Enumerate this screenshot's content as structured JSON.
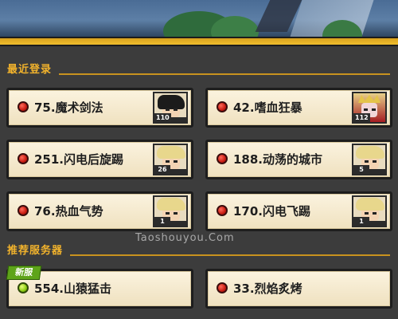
{
  "sections": {
    "recent": "最近登录",
    "recommended": "推荐服务器"
  },
  "recent_servers": [
    {
      "label": "75.魔术剑法",
      "status": "red",
      "avatar": "black-hair-hero",
      "level": "110"
    },
    {
      "label": "42.嗜血狂暴",
      "status": "red",
      "avatar": "crowned-villain",
      "level": "112"
    },
    {
      "label": "251.闪电后旋踢",
      "status": "red",
      "avatar": "blond-cyborg",
      "level": "26"
    },
    {
      "label": "188.动荡的城市",
      "status": "red",
      "avatar": "blond-cyborg",
      "level": "5"
    },
    {
      "label": "76.热血气势",
      "status": "red",
      "avatar": "blond-cyborg",
      "level": "1"
    },
    {
      "label": "170.闪电飞踢",
      "status": "red",
      "avatar": "blond-cyborg",
      "level": "1"
    }
  ],
  "recommended_servers": [
    {
      "label": "554.山猿猛击",
      "status": "green",
      "badge": "新服"
    },
    {
      "label": "33.烈焰炙烤",
      "status": "red"
    }
  ],
  "watermark": "Taoshouyou.Com",
  "colors": {
    "accent": "#f2b32c",
    "card": "#f6ead0",
    "background": "#3c3c3c"
  }
}
